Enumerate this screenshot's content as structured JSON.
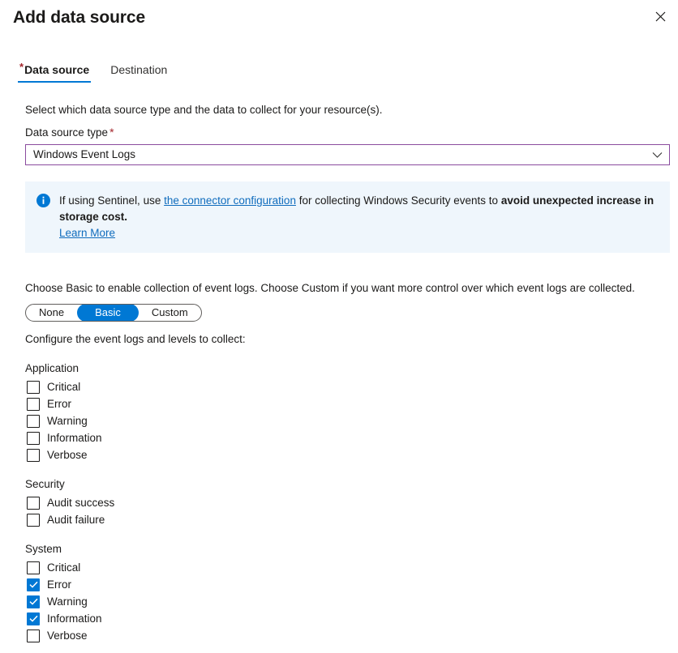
{
  "header": {
    "title": "Add data source",
    "close_icon": "close-icon"
  },
  "tabs": [
    {
      "label": "Data source",
      "required": true,
      "active": true
    },
    {
      "label": "Destination",
      "required": false,
      "active": false
    }
  ],
  "intro_text": "Select which data source type and the data to collect for your resource(s).",
  "data_source_type": {
    "label": "Data source type",
    "required_marker": "*",
    "value": "Windows Event Logs",
    "chevron_icon": "chevron-down-icon"
  },
  "info_banner": {
    "icon": "info-icon",
    "prefix": "If using Sentinel, use ",
    "link_text": "the connector configuration",
    "middle": " for collecting Windows Security events to ",
    "bold_text": "avoid unexpected increase in storage cost.",
    "learn_more": "Learn More"
  },
  "choose_text": "Choose Basic to enable collection of event logs. Choose Custom if you want more control over which event logs are collected.",
  "mode_toggle": {
    "options": [
      "None",
      "Basic",
      "Custom"
    ],
    "selected": "Basic"
  },
  "configure_text": "Configure the event logs and levels to collect:",
  "checkbox_groups": [
    {
      "title": "Application",
      "items": [
        {
          "label": "Critical",
          "checked": false
        },
        {
          "label": "Error",
          "checked": false
        },
        {
          "label": "Warning",
          "checked": false
        },
        {
          "label": "Information",
          "checked": false
        },
        {
          "label": "Verbose",
          "checked": false
        }
      ]
    },
    {
      "title": "Security",
      "items": [
        {
          "label": "Audit success",
          "checked": false
        },
        {
          "label": "Audit failure",
          "checked": false
        }
      ]
    },
    {
      "title": "System",
      "items": [
        {
          "label": "Critical",
          "checked": false
        },
        {
          "label": "Error",
          "checked": true
        },
        {
          "label": "Warning",
          "checked": true
        },
        {
          "label": "Information",
          "checked": true
        },
        {
          "label": "Verbose",
          "checked": false
        }
      ]
    }
  ],
  "colors": {
    "accent": "#0078d4",
    "required_red": "#a4262c",
    "field_border_purple": "#8a4b9e",
    "info_bg": "#eff6fc",
    "link": "#0f6cbd"
  }
}
